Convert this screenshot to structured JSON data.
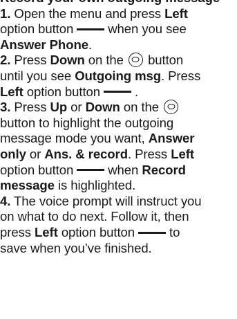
{
  "title": "Record your own outgoing message",
  "steps": [
    {
      "number": "1.",
      "t1": "Open the menu and press",
      "k1": "Left",
      "t2": "option button",
      "t3": "when you see",
      "k2": "Answer Phone",
      "t4": "."
    },
    {
      "number": "2.",
      "t1": "Press",
      "k1": "Down",
      "t2": "on the",
      "t3": "button",
      "t4": "until you see",
      "k2": "Outgoing msg",
      "t5": ". Press",
      "k3": "Left",
      "t6": "option button",
      "t7": "."
    },
    {
      "number": "3.",
      "t1": "Press",
      "k1": "Up",
      "t2": "or",
      "k2": "Down",
      "t3": "on the",
      "t4": "button to highlight the outgoing",
      "t5": "message mode you want,",
      "k3": "Answer",
      "k3b": "only",
      "t6": "or",
      "k4": "Ans. & record",
      "t7": ". Press",
      "k5": "Left",
      "t8": "option button",
      "t9": "when",
      "k6": "Record",
      "k6b": "message",
      "t10": "is highlighted."
    },
    {
      "number": "4.",
      "t1": "The voice prompt will instruct you",
      "t2": "on what to do next. Follow it, then",
      "t3": "press",
      "k1": "Left",
      "t4": "option button",
      "t5": "to",
      "t6": "save when you’ve finished."
    }
  ],
  "icons": {
    "option_button": "left-option-button-dash-icon",
    "nav_button": "navigation-key-icon"
  }
}
